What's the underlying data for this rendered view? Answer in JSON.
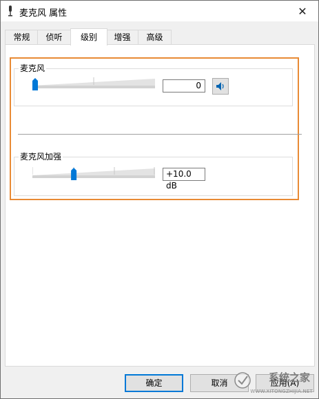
{
  "window": {
    "title": "麦克风 属性",
    "close_glyph": "✕"
  },
  "tabs": [
    {
      "label": "常规",
      "active": false
    },
    {
      "label": "侦听",
      "active": false
    },
    {
      "label": "级别",
      "active": true
    },
    {
      "label": "增强",
      "active": false
    },
    {
      "label": "高级",
      "active": false
    }
  ],
  "levels": {
    "microphone": {
      "label": "麦克风",
      "value": "0",
      "slider_fraction": 0.0
    },
    "boost": {
      "label": "麦克风加强",
      "value": "+10.0 dB",
      "slider_fraction": 0.33
    }
  },
  "buttons": {
    "ok": "确定",
    "cancel": "取消",
    "apply": "应用(A)"
  },
  "watermark": {
    "text": "系统之家",
    "url": "WWW.XITONGZHIJIA.NET"
  },
  "colors": {
    "highlight": "#e88a34",
    "accent": "#0078d7"
  },
  "icons": {
    "speaker": "speaker-icon",
    "close": "close-icon",
    "microphone": "microphone-icon"
  }
}
